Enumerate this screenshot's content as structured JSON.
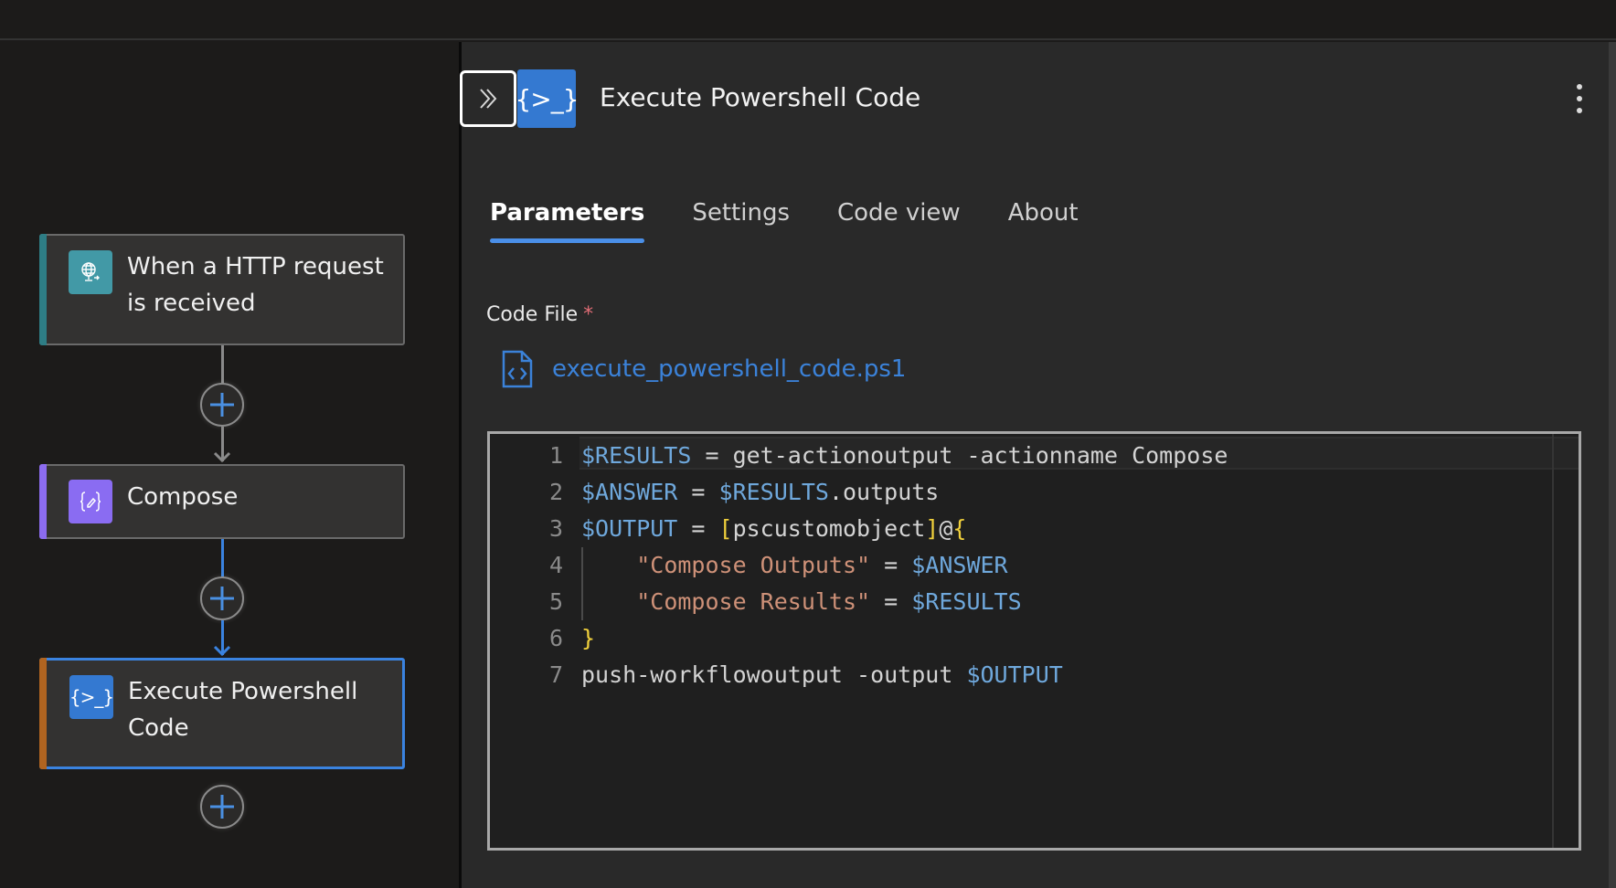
{
  "flow": {
    "nodes": [
      {
        "id": "http",
        "label": "When a HTTP request is received",
        "icon": "globe-request-icon",
        "accent": "#2e7d85",
        "icon_bg": "#4299a6"
      },
      {
        "id": "compose",
        "label": "Compose",
        "icon": "compose-braces-icon",
        "accent": "#8c6cf0",
        "icon_bg": "#8a6cf2"
      },
      {
        "id": "exec",
        "label": "Execute Powershell Code",
        "icon": "powershell-icon",
        "accent": "#b06420",
        "icon_bg": "#3479d1",
        "selected": true
      }
    ],
    "add_step_label": "+"
  },
  "panel": {
    "title": "Execute Powershell Code",
    "collapse_icon": "chevron-double-right-icon",
    "header_icon_text": "{>_}",
    "more_icon": "more-vertical-icon",
    "tabs": [
      {
        "label": "Parameters",
        "active": true
      },
      {
        "label": "Settings",
        "active": false
      },
      {
        "label": "Code view",
        "active": false
      },
      {
        "label": "About",
        "active": false
      }
    ],
    "field": {
      "label": "Code File",
      "required_marker": "*",
      "file_name": "execute_powershell_code.ps1"
    },
    "code": {
      "language": "powershell",
      "lines": [
        {
          "n": "1",
          "tokens": [
            [
              "var",
              "$RESULTS"
            ],
            [
              "plain",
              " = get-actionoutput -actionname Compose"
            ]
          ]
        },
        {
          "n": "2",
          "tokens": [
            [
              "var",
              "$ANSWER"
            ],
            [
              "plain",
              " = "
            ],
            [
              "var",
              "$RESULTS"
            ],
            [
              "plain",
              ".outputs"
            ]
          ]
        },
        {
          "n": "3",
          "tokens": [
            [
              "var",
              "$OUTPUT"
            ],
            [
              "plain",
              " = "
            ],
            [
              "brk",
              "["
            ],
            [
              "plain",
              "pscustomobject"
            ],
            [
              "brk",
              "]"
            ],
            [
              "plain",
              "@"
            ],
            [
              "brk",
              "{"
            ]
          ]
        },
        {
          "n": "4",
          "tokens": [
            [
              "plain",
              "    "
            ],
            [
              "str",
              "\"Compose Outputs\""
            ],
            [
              "plain",
              " = "
            ],
            [
              "var",
              "$ANSWER"
            ]
          ]
        },
        {
          "n": "5",
          "tokens": [
            [
              "plain",
              "    "
            ],
            [
              "str",
              "\"Compose Results\""
            ],
            [
              "plain",
              " = "
            ],
            [
              "var",
              "$RESULTS"
            ]
          ]
        },
        {
          "n": "6",
          "tokens": [
            [
              "brk",
              "}"
            ]
          ]
        },
        {
          "n": "7",
          "tokens": [
            [
              "plain",
              "push-workflowoutput -output "
            ],
            [
              "var",
              "$OUTPUT"
            ]
          ]
        }
      ]
    }
  },
  "colors": {
    "accent_blue": "#3a83e0",
    "link_blue": "#3b82d9",
    "required_red": "#e06c75"
  }
}
